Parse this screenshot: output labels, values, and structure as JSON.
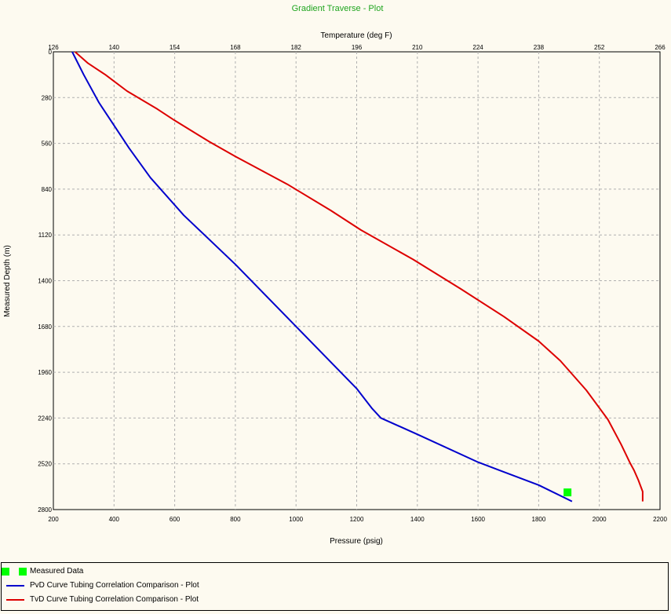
{
  "chart_data": {
    "type": "line",
    "title": "Gradient Traverse - Plot",
    "xlabel_bottom": "Pressure  (psig)",
    "xlabel_top": "Temperature  (deg F)",
    "ylabel": "Measured Depth  (m)",
    "x_bottom_range": [
      200,
      2200
    ],
    "x_top_range": [
      126,
      266
    ],
    "y_range": [
      0,
      2800
    ],
    "y_inverted": true,
    "grid": true,
    "legend_position": "bottom",
    "x_bottom_ticks": [
      "200",
      "400",
      "600",
      "800",
      "1000",
      "1200",
      "1400",
      "1600",
      "1800",
      "2000",
      "2200"
    ],
    "x_top_ticks": [
      "126",
      "140",
      "154",
      "168",
      "182",
      "196",
      "210",
      "224",
      "238",
      "252",
      "266"
    ],
    "y_ticks": [
      "0",
      "280",
      "560",
      "840",
      "1120",
      "1400",
      "1680",
      "1960",
      "2240",
      "2520",
      "2800"
    ],
    "measured_data": {
      "name": "Measured Data",
      "color": "#00ff00",
      "points": [
        {
          "pressure": 1895,
          "depth": 2695
        }
      ]
    },
    "series": [
      {
        "name": "PvD Curve Tubing Correlation Comparison - Plot",
        "axis": "pressure",
        "color": "#0000cc",
        "points": [
          [
            262,
            0
          ],
          [
            300,
            140
          ],
          [
            350,
            310
          ],
          [
            400,
            450
          ],
          [
            450,
            590
          ],
          [
            520,
            770
          ],
          [
            630,
            1000
          ],
          [
            800,
            1300
          ],
          [
            1000,
            1680
          ],
          [
            1200,
            2060
          ],
          [
            1250,
            2180
          ],
          [
            1280,
            2240
          ],
          [
            1400,
            2340
          ],
          [
            1600,
            2510
          ],
          [
            1800,
            2650
          ],
          [
            1910,
            2750
          ]
        ]
      },
      {
        "name": "TvD Curve Tubing Correlation Comparison - Plot",
        "axis": "temperature",
        "color": "#dd0000",
        "points": [
          [
            131,
            0
          ],
          [
            134,
            70
          ],
          [
            138,
            140
          ],
          [
            143,
            240
          ],
          [
            150,
            350
          ],
          [
            154,
            420
          ],
          [
            162,
            550
          ],
          [
            168,
            640
          ],
          [
            180,
            810
          ],
          [
            190,
            970
          ],
          [
            197,
            1090
          ],
          [
            209,
            1270
          ],
          [
            220,
            1450
          ],
          [
            230,
            1620
          ],
          [
            238,
            1770
          ],
          [
            243,
            1890
          ],
          [
            249,
            2070
          ],
          [
            254,
            2250
          ],
          [
            257,
            2400
          ],
          [
            259,
            2510
          ],
          [
            260,
            2560
          ],
          [
            261,
            2620
          ],
          [
            262,
            2690
          ],
          [
            262,
            2750
          ]
        ]
      }
    ]
  }
}
